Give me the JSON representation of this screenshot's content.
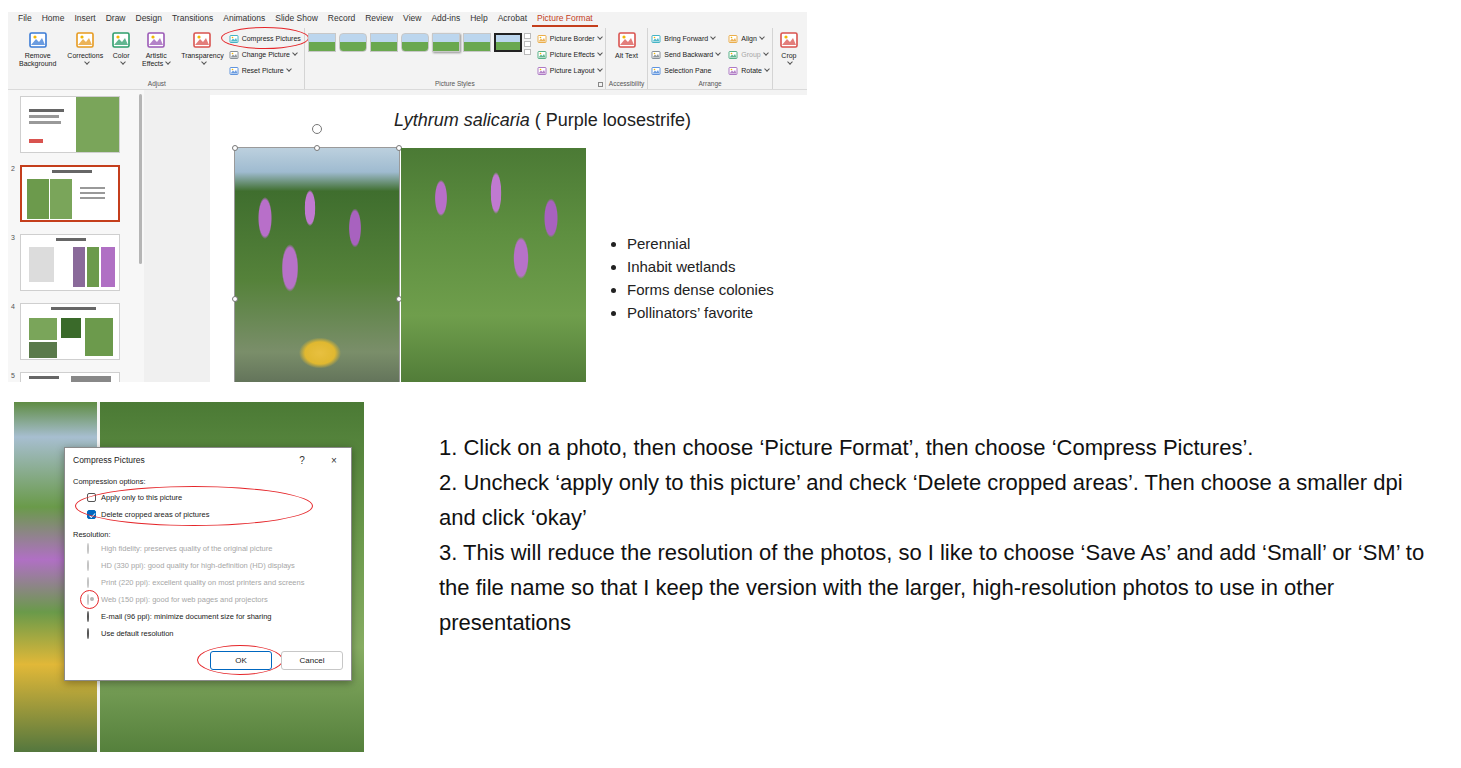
{
  "ppt": {
    "tabs": [
      {
        "label": "File",
        "selected": false
      },
      {
        "label": "Home",
        "selected": false
      },
      {
        "label": "Insert",
        "selected": false
      },
      {
        "label": "Draw",
        "selected": false
      },
      {
        "label": "Design",
        "selected": false
      },
      {
        "label": "Transitions",
        "selected": false
      },
      {
        "label": "Animations",
        "selected": false
      },
      {
        "label": "Slide Show",
        "selected": false
      },
      {
        "label": "Record",
        "selected": false
      },
      {
        "label": "Review",
        "selected": false
      },
      {
        "label": "View",
        "selected": false
      },
      {
        "label": "Add-ins",
        "selected": false
      },
      {
        "label": "Help",
        "selected": false
      },
      {
        "label": "Acrobat",
        "selected": false
      },
      {
        "label": "Picture Format",
        "selected": true
      }
    ],
    "ribbon": {
      "adjust": {
        "label": "Adjust",
        "large": [
          {
            "label": "Remove Background",
            "menu": false
          },
          {
            "label": "Corrections",
            "menu": true
          },
          {
            "label": "Color",
            "menu": true
          },
          {
            "label": "Artistic Effects",
            "menu": true
          },
          {
            "label": "Transparency",
            "menu": true
          }
        ],
        "small": [
          {
            "label": "Compress Pictures",
            "menu": false
          },
          {
            "label": "Change Picture",
            "menu": true
          },
          {
            "label": "Reset Picture",
            "menu": true
          }
        ]
      },
      "styles": {
        "label": "Picture Styles",
        "options": [
          {
            "label": "Picture Border",
            "menu": true
          },
          {
            "label": "Picture Effects",
            "menu": true
          },
          {
            "label": "Picture Layout",
            "menu": true
          }
        ]
      },
      "accessibility": {
        "label": "Accessibility",
        "button": "Alt Text"
      },
      "arrange": {
        "label": "Arrange",
        "columns": [
          [
            {
              "label": "Bring Forward",
              "menu": true,
              "disabled": false
            },
            {
              "label": "Send Backward",
              "menu": true,
              "disabled": false
            },
            {
              "label": "Selection Pane",
              "menu": false,
              "disabled": false
            }
          ],
          [
            {
              "label": "Align",
              "menu": true,
              "disabled": false
            },
            {
              "label": "Group",
              "menu": true,
              "disabled": true
            },
            {
              "label": "Rotate",
              "menu": true,
              "disabled": false
            }
          ]
        ]
      },
      "crop": {
        "label": "Crop",
        "menu": true
      }
    },
    "slides": [
      {
        "selected": false
      },
      {
        "number": "2",
        "selected": true
      },
      {
        "number": "3",
        "selected": false
      },
      {
        "number": "4",
        "selected": false
      },
      {
        "number": "5",
        "selected": false
      }
    ],
    "slide": {
      "title_species": "Lythrum salicaria",
      "title_common": " ( Purple loosestrife)",
      "photos": [
        {
          "selected": true
        },
        {
          "selected": false
        }
      ],
      "bullets": [
        "Perennial",
        "Inhabit wetlands",
        "Forms dense colonies",
        "Pollinators’ favorite"
      ]
    }
  },
  "dialog": {
    "title": "Compress Pictures",
    "help": "?",
    "close": "×",
    "compression_label": "Compression options:",
    "checkboxes": [
      {
        "label": "Apply only to this picture",
        "checked": false
      },
      {
        "label": "Delete cropped areas of pictures",
        "checked": true
      }
    ],
    "resolution_label": "Resolution:",
    "radios": [
      {
        "label": "High fidelity: preserves quality of the original picture",
        "selected": false,
        "disabled": true
      },
      {
        "label": "HD (330 ppi): good quality for high-definition (HD) displays",
        "selected": false,
        "disabled": true
      },
      {
        "label": "Print (220 ppi): excellent quality on most printers and screens",
        "selected": false,
        "disabled": true
      },
      {
        "label": "Web (150 ppi): good for web pages and projectors",
        "selected": true,
        "disabled": true
      },
      {
        "label": "E-mail (96 ppi): minimize document size for sharing",
        "selected": false,
        "disabled": false
      },
      {
        "label": "Use default resolution",
        "selected": false,
        "disabled": false
      }
    ],
    "buttons": [
      {
        "label": "OK",
        "default": true
      },
      {
        "label": "Cancel",
        "default": false
      }
    ]
  },
  "instructions": [
    "1. Click on a photo, then choose ‘Picture Format’, then choose ‘Compress Pictures’.",
    "2. Uncheck ‘apply only to this picture’ and check ‘Delete cropped areas’. Then choose a smaller dpi and click ‘okay’",
    "3. This will reduce the resolution of the photos, so I like to choose ‘Save As’ and add ‘Small’ or ‘SM’ to the file name so that I keep the version with the larger, high-resolution photos to use in other presentations"
  ]
}
